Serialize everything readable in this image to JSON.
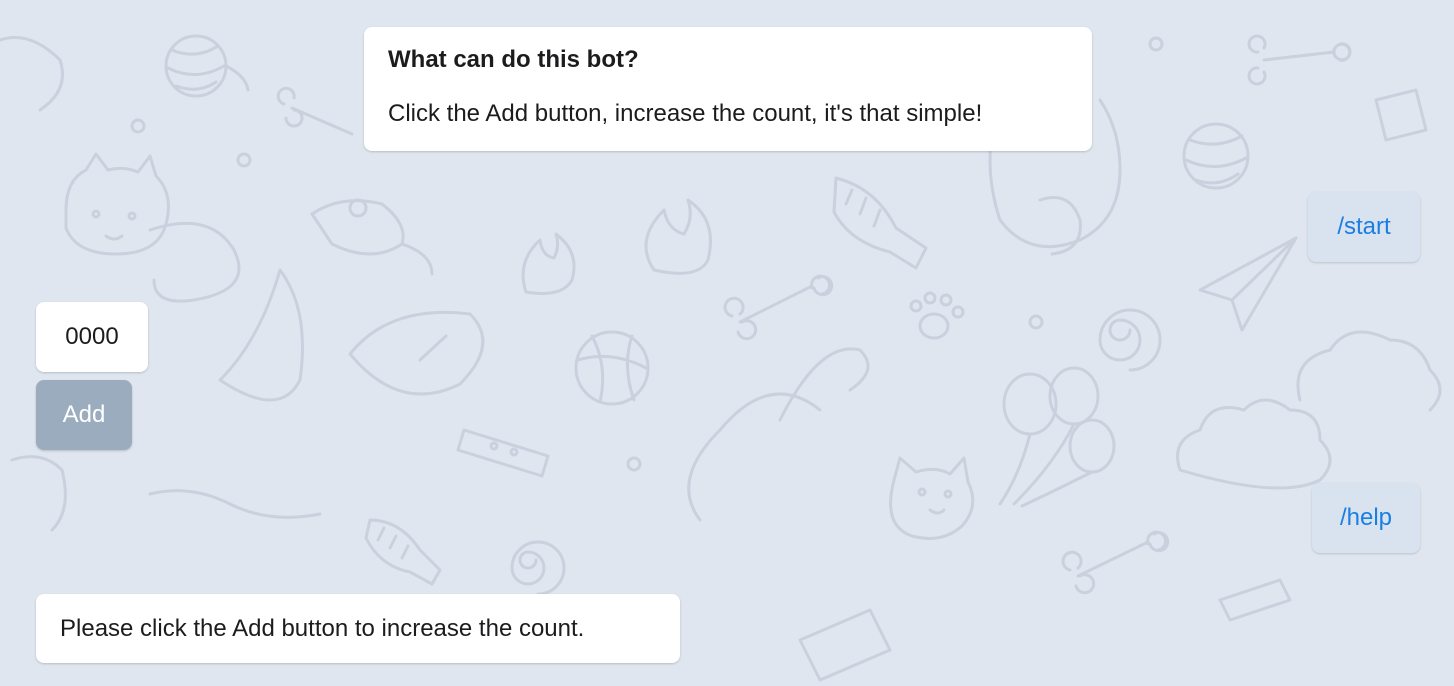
{
  "theme": {
    "background": "#dfe6ef",
    "pattern_stroke": "#c8d1dd",
    "bubble_background": "#ffffff",
    "user_bubble_background": "#d8e3ef",
    "command_color": "#1a7ee3",
    "add_button_background": "#9bacbf",
    "add_button_text": "#ffffff"
  },
  "messages": {
    "intro": {
      "title": "What can do this bot?",
      "body": "Click the Add button, increase the count, it's that simple!"
    },
    "start_command": "/start",
    "count_display": "0000",
    "add_button_label": "Add",
    "help_command": "/help",
    "prompt": "Please click the Add button to increase the count."
  },
  "background_icons": [
    "cat-icon",
    "bone-icon",
    "yarn-ball-icon",
    "fish-skeleton-icon",
    "ball-icon",
    "paw-icon",
    "flame-icon",
    "spiral-icon",
    "paper-plane-icon",
    "balloon-icon",
    "mouse-icon",
    "collar-icon",
    "cloud-icon"
  ]
}
